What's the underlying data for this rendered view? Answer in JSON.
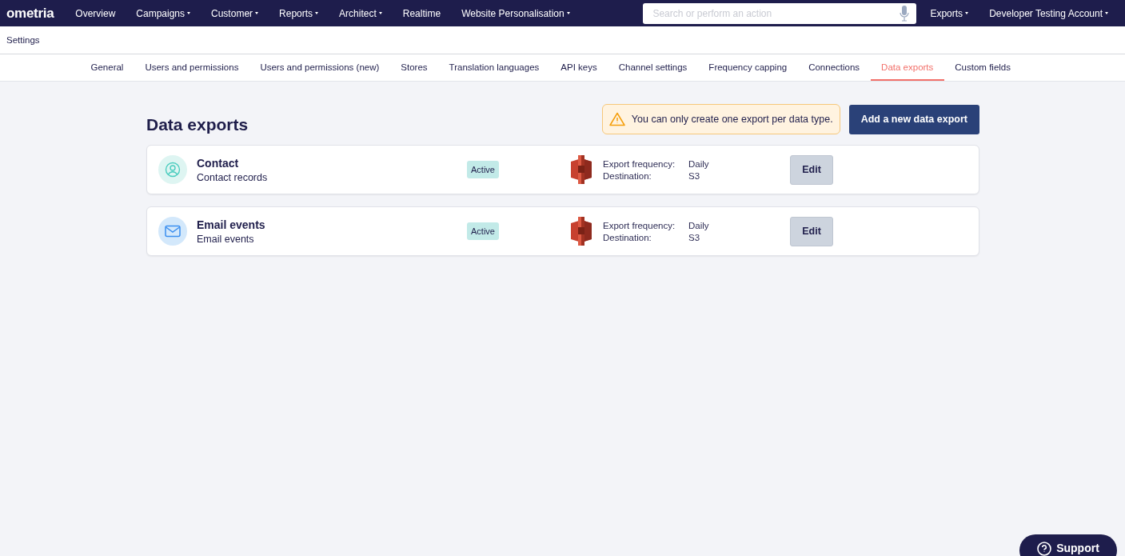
{
  "nav": {
    "logo": "ometria",
    "items": [
      {
        "label": "Overview",
        "dropdown": false
      },
      {
        "label": "Campaigns",
        "dropdown": true
      },
      {
        "label": "Customer",
        "dropdown": true
      },
      {
        "label": "Reports",
        "dropdown": true
      },
      {
        "label": "Architect",
        "dropdown": true
      },
      {
        "label": "Realtime",
        "dropdown": false
      },
      {
        "label": "Website Personalisation",
        "dropdown": true
      }
    ],
    "search": {
      "placeholder": "Search or perform an action"
    },
    "right_items": [
      {
        "label": "Exports",
        "dropdown": true
      },
      {
        "label": "Developer Testing Account",
        "dropdown": true
      }
    ]
  },
  "breadcrumb": "Settings",
  "tabs": [
    {
      "label": "General",
      "selected": false
    },
    {
      "label": "Users and permissions",
      "selected": false
    },
    {
      "label": "Users and permissions (new)",
      "selected": false
    },
    {
      "label": "Stores",
      "selected": false
    },
    {
      "label": "Translation languages",
      "selected": false
    },
    {
      "label": "API keys",
      "selected": false
    },
    {
      "label": "Channel settings",
      "selected": false
    },
    {
      "label": "Frequency capping",
      "selected": false
    },
    {
      "label": "Connections",
      "selected": false
    },
    {
      "label": "Data exports",
      "selected": true
    },
    {
      "label": "Custom fields",
      "selected": false
    }
  ],
  "page_title": "Data exports",
  "notice": "You can only create one export per data type.",
  "add_button": "Add a new data export",
  "exports": [
    {
      "kind": "contact",
      "title": "Contact",
      "subtitle": "Contact records",
      "status": "Active",
      "frequency_label": "Export frequency:",
      "frequency": "Daily",
      "destination_label": "Destination:",
      "destination": "S3",
      "edit": "Edit"
    },
    {
      "kind": "email",
      "title": "Email events",
      "subtitle": "Email events",
      "status": "Active",
      "frequency_label": "Export frequency:",
      "frequency": "Daily",
      "destination_label": "Destination:",
      "destination": "S3",
      "edit": "Edit"
    }
  ],
  "support_button": "Support"
}
